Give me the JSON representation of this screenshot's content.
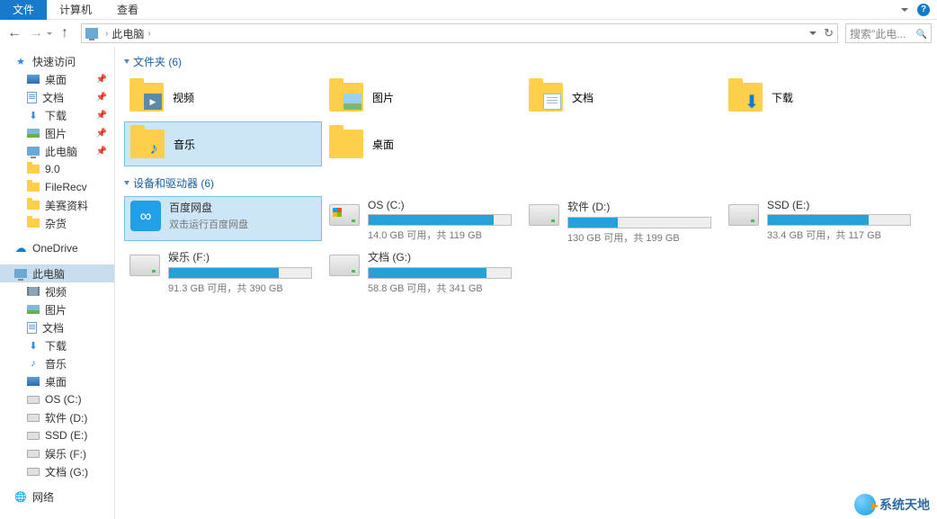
{
  "menubar": {
    "file": "文件",
    "computer": "计算机",
    "view": "查看"
  },
  "breadcrumb": {
    "root": "此电脑"
  },
  "search": {
    "placeholder": "搜索\"此电...",
    "magnifier": "🔍"
  },
  "sidebar": {
    "quick": "快速访问",
    "pinned": [
      {
        "label": "桌面",
        "icon": "desktop"
      },
      {
        "label": "文档",
        "icon": "doc"
      },
      {
        "label": "下载",
        "icon": "download"
      },
      {
        "label": "图片",
        "icon": "pic"
      },
      {
        "label": "此电脑",
        "icon": "pc"
      }
    ],
    "recent": [
      {
        "label": "9.0"
      },
      {
        "label": "FileRecv"
      },
      {
        "label": "美赛资料"
      },
      {
        "label": "杂货"
      }
    ],
    "onedrive": "OneDrive",
    "thispc": "此电脑",
    "pcitems": [
      {
        "label": "视频",
        "icon": "video"
      },
      {
        "label": "图片",
        "icon": "pic"
      },
      {
        "label": "文档",
        "icon": "doc"
      },
      {
        "label": "下载",
        "icon": "download"
      },
      {
        "label": "音乐",
        "icon": "music"
      },
      {
        "label": "桌面",
        "icon": "desktop"
      },
      {
        "label": "OS (C:)",
        "icon": "drive"
      },
      {
        "label": "软件 (D:)",
        "icon": "drive"
      },
      {
        "label": "SSD (E:)",
        "icon": "drive"
      },
      {
        "label": "娱乐 (F:)",
        "icon": "drive"
      },
      {
        "label": "文档 (G:)",
        "icon": "drive"
      }
    ],
    "network": "网络"
  },
  "groups": {
    "folders": {
      "title": "文件夹 (6)"
    },
    "devices": {
      "title": "设备和驱动器 (6)"
    }
  },
  "folders": [
    {
      "label": "视频",
      "overlay": "video"
    },
    {
      "label": "图片",
      "overlay": "pic"
    },
    {
      "label": "文档",
      "overlay": "doc"
    },
    {
      "label": "下载",
      "overlay": "download"
    },
    {
      "label": "音乐",
      "overlay": "music",
      "selected": true
    },
    {
      "label": "桌面",
      "overlay": ""
    }
  ],
  "devices": [
    {
      "name": "百度网盘",
      "sub": "双击运行百度网盘",
      "type": "app",
      "selected": true
    },
    {
      "name": "OS (C:)",
      "sub": "14.0 GB 可用，共 119 GB",
      "fill": 88,
      "win": true
    },
    {
      "name": "软件 (D:)",
      "sub": "130 GB 可用，共 199 GB",
      "fill": 35
    },
    {
      "name": "SSD (E:)",
      "sub": "33.4 GB 可用，共 117 GB",
      "fill": 71
    },
    {
      "name": "娱乐 (F:)",
      "sub": "91.3 GB 可用，共 390 GB",
      "fill": 77
    },
    {
      "name": "文档 (G:)",
      "sub": "58.8 GB 可用，共 341 GB",
      "fill": 83
    }
  ],
  "watermark": "系统天地"
}
